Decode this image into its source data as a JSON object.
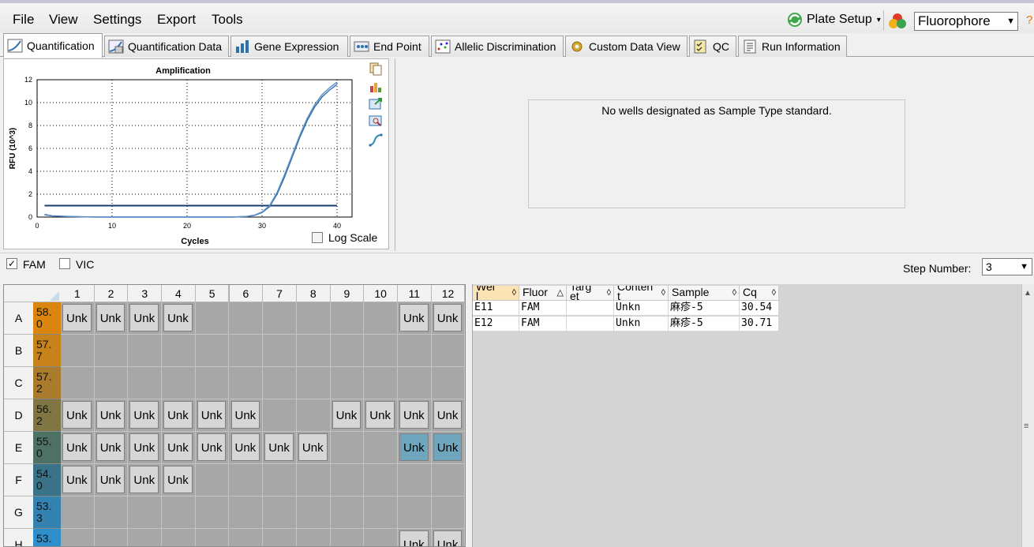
{
  "menu": {
    "file": "File",
    "view": "View",
    "settings": "Settings",
    "export": "Export",
    "tools": "Tools"
  },
  "toolbar": {
    "plate_setup": "Plate Setup",
    "fluorophore": "Fluorophore"
  },
  "tabs": [
    "Quantification",
    "Quantification Data",
    "Gene Expression",
    "End Point",
    "Allelic Discrimination",
    "Custom Data View",
    "QC",
    "Run Information"
  ],
  "chart": {
    "title": "Amplification",
    "xlabel": "Cycles",
    "ylabel": "RFU (10^3)",
    "log_scale_label": "Log Scale"
  },
  "chart_data": {
    "type": "line",
    "title": "Amplification",
    "xlabel": "Cycles",
    "ylabel": "RFU (10^3)",
    "xlim": [
      0,
      42
    ],
    "ylim": [
      0,
      12
    ],
    "xticks": [
      0,
      10,
      20,
      30,
      40
    ],
    "yticks": [
      0,
      2,
      4,
      6,
      8,
      10,
      12
    ],
    "grid": true,
    "series": [
      {
        "x": [
          1,
          2,
          4,
          6,
          8,
          10,
          12,
          14,
          16,
          18,
          20,
          22,
          24,
          26,
          28,
          29,
          30,
          31,
          32,
          33,
          34,
          35,
          36,
          37,
          38,
          39,
          40
        ],
        "y": [
          0.2,
          0.1,
          0.05,
          0.02,
          0.0,
          0.0,
          0.0,
          0.0,
          0.0,
          0.0,
          0.0,
          0.0,
          0.0,
          0.0,
          0.05,
          0.15,
          0.4,
          0.9,
          2.0,
          3.5,
          5.2,
          6.9,
          8.4,
          9.6,
          10.5,
          11.1,
          11.6
        ]
      },
      {
        "x": [
          1,
          2,
          4,
          6,
          8,
          10,
          12,
          14,
          16,
          18,
          20,
          22,
          24,
          26,
          28,
          29,
          30,
          31,
          32,
          33,
          34,
          35,
          36,
          37,
          38,
          39,
          40
        ],
        "y": [
          0.25,
          0.12,
          0.06,
          0.03,
          0.01,
          0.0,
          0.0,
          0.0,
          0.0,
          0.0,
          0.0,
          0.0,
          0.0,
          0.0,
          0.06,
          0.17,
          0.45,
          1.0,
          2.15,
          3.7,
          5.4,
          7.1,
          8.6,
          9.8,
          10.7,
          11.3,
          11.8
        ]
      }
    ],
    "threshold": 1.0,
    "threshold_range": [
      1,
      40
    ]
  },
  "std_message": "No wells designated as Sample Type standard.",
  "filters": {
    "fam": "FAM",
    "vic": "VIC",
    "step_label": "Step Number:",
    "step_value": "3"
  },
  "plate": {
    "columns": [
      "1",
      "2",
      "3",
      "4",
      "5",
      "6",
      "7",
      "8",
      "9",
      "10",
      "11",
      "12"
    ],
    "rows": [
      {
        "label": "A",
        "temp": "58.\n0",
        "color": "#d9850f",
        "wells": [
          "Unk",
          "Unk",
          "Unk",
          "Unk",
          "",
          "",
          "",
          "",
          "",
          "",
          "Unk",
          "Unk"
        ]
      },
      {
        "label": "B",
        "temp": "57.\n7",
        "color": "#c7821b",
        "wells": [
          "",
          "",
          "",
          "",
          "",
          "",
          "",
          "",
          "",
          "",
          "",
          ""
        ]
      },
      {
        "label": "C",
        "temp": "57.\n2",
        "color": "#aa7b2c",
        "wells": [
          "",
          "",
          "",
          "",
          "",
          "",
          "",
          "",
          "",
          "",
          "",
          ""
        ]
      },
      {
        "label": "D",
        "temp": "56.\n2",
        "color": "#7f7643",
        "wells": [
          "Unk",
          "Unk",
          "Unk",
          "Unk",
          "Unk",
          "Unk",
          "",
          "",
          "Unk",
          "Unk",
          "Unk",
          "Unk"
        ]
      },
      {
        "label": "E",
        "temp": "55.\n0",
        "color": "#4d7264",
        "wells": [
          "Unk",
          "Unk",
          "Unk",
          "Unk",
          "Unk",
          "Unk",
          "Unk",
          "Unk",
          "",
          "",
          "Unk",
          "Unk"
        ]
      },
      {
        "label": "F",
        "temp": "54.\n0",
        "color": "#3a7287",
        "wells": [
          "Unk",
          "Unk",
          "Unk",
          "Unk",
          "",
          "",
          "",
          "",
          "",
          "",
          "",
          ""
        ]
      },
      {
        "label": "G",
        "temp": "53.\n3",
        "color": "#3382b0",
        "wells": [
          "",
          "",
          "",
          "",
          "",
          "",
          "",
          "",
          "",
          "",
          "",
          ""
        ]
      },
      {
        "label": "H",
        "temp": "53.",
        "color": "#2f8fca",
        "wells": [
          "",
          "",
          "",
          "",
          "",
          "",
          "",
          "",
          "",
          "",
          "Unk",
          "Unk"
        ]
      }
    ],
    "selected": [
      "E11",
      "E12"
    ]
  },
  "table": {
    "headers": [
      "Wel\nl",
      "Fluor",
      "Targ\net",
      "Conten\nt",
      "Sample",
      "Cq"
    ],
    "rows": [
      [
        "E11",
        "FAM",
        "",
        "Unkn",
        "麻疹-5",
        "30.54"
      ],
      [
        "E12",
        "FAM",
        "",
        "Unkn",
        "麻疹-5",
        "30.71"
      ]
    ]
  },
  "colors": {
    "selected_well": "#6fa6bd",
    "curve": "#2e6fae",
    "threshold": "#1a3f6f"
  }
}
